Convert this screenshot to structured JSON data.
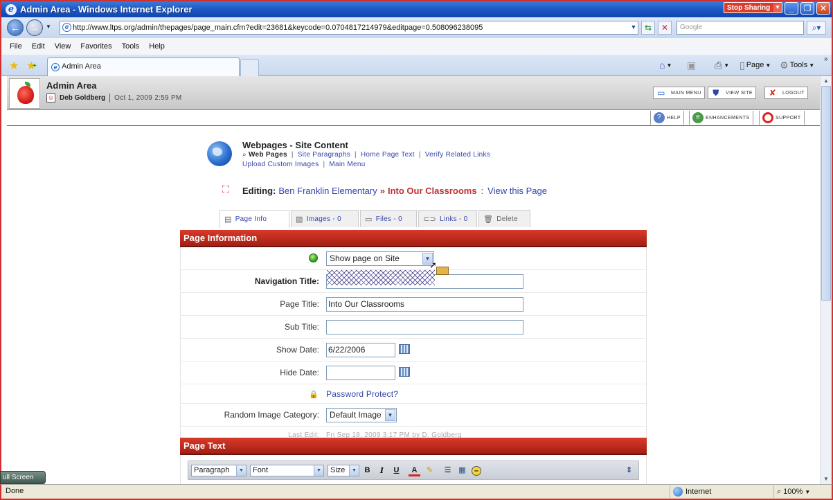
{
  "browser": {
    "window_title": "Admin Area - Windows Internet Explorer",
    "stop_sharing_label": "Stop Sharing",
    "url": "http://www.ltps.org/admin/thepages/page_main.cfm?edit=23681&keycode=0.0704817214979&editpage=0.508096238095",
    "search_placeholder": "Google",
    "menu": [
      "File",
      "Edit",
      "View",
      "Favorites",
      "Tools",
      "Help"
    ],
    "tab_label": "Admin Area",
    "cmd_page": "Page",
    "cmd_tools": "Tools",
    "status_text": "Done",
    "zone_label": "Internet",
    "zoom_level": "100%",
    "full_screen_label": "ull Screen"
  },
  "admin_header": {
    "title": "Admin Area",
    "user_name": "Deb Goldberg",
    "date": "Oct 1, 2009 2:59 PM",
    "buttons": [
      "Main Menu",
      "View Site",
      "Logout"
    ],
    "sub_buttons": [
      "Help",
      "Enhancements",
      "Support"
    ]
  },
  "content": {
    "section_title": "Webpages - Site Content",
    "current_link": "Web Pages",
    "links_row1": [
      "Site Paragraphs",
      "Home Page Text",
      "Verify Related Links"
    ],
    "links_row2": [
      "Upload Custom Images",
      "Main Menu"
    ],
    "editing_label": "Editing:",
    "breadcrumb_site": "Ben Franklin Elementary",
    "breadcrumb_sep": "»",
    "breadcrumb_page": "Into Our Classrooms",
    "breadcrumb_colon": ":",
    "view_page_link": "View this Page"
  },
  "tabs": [
    "Page Info",
    "Images - 0",
    "Files - 0",
    "Links - 0",
    "Delete"
  ],
  "page_info": {
    "header": "Page Information",
    "visibility_value": "Show page on Site",
    "navigation_title_label": "Navigation Title:",
    "navigation_title_value": "",
    "page_title_label": "Page Title:",
    "page_title_value": "Into Our Classrooms",
    "sub_title_label": "Sub Title:",
    "sub_title_value": "",
    "show_date_label": "Show Date:",
    "show_date_value": "6/22/2006",
    "hide_date_label": "Hide Date:",
    "hide_date_value": "",
    "password_link": "Password Protect?",
    "random_image_label": "Random Image Category:",
    "random_image_value": "Default Image",
    "last_edit_label": "Last Edit:",
    "last_edit_value": "Fri Sep 18, 2009 3:17 PM by D. Goldberg"
  },
  "page_text": {
    "header": "Page Text",
    "format_value": "Paragraph",
    "font_value": "Font",
    "size_value": "Size"
  },
  "colors": {
    "section_header_red": "#c22a1c",
    "link_blue": "#3344aa",
    "ie_titlebar_blue": "#1c58c4"
  }
}
